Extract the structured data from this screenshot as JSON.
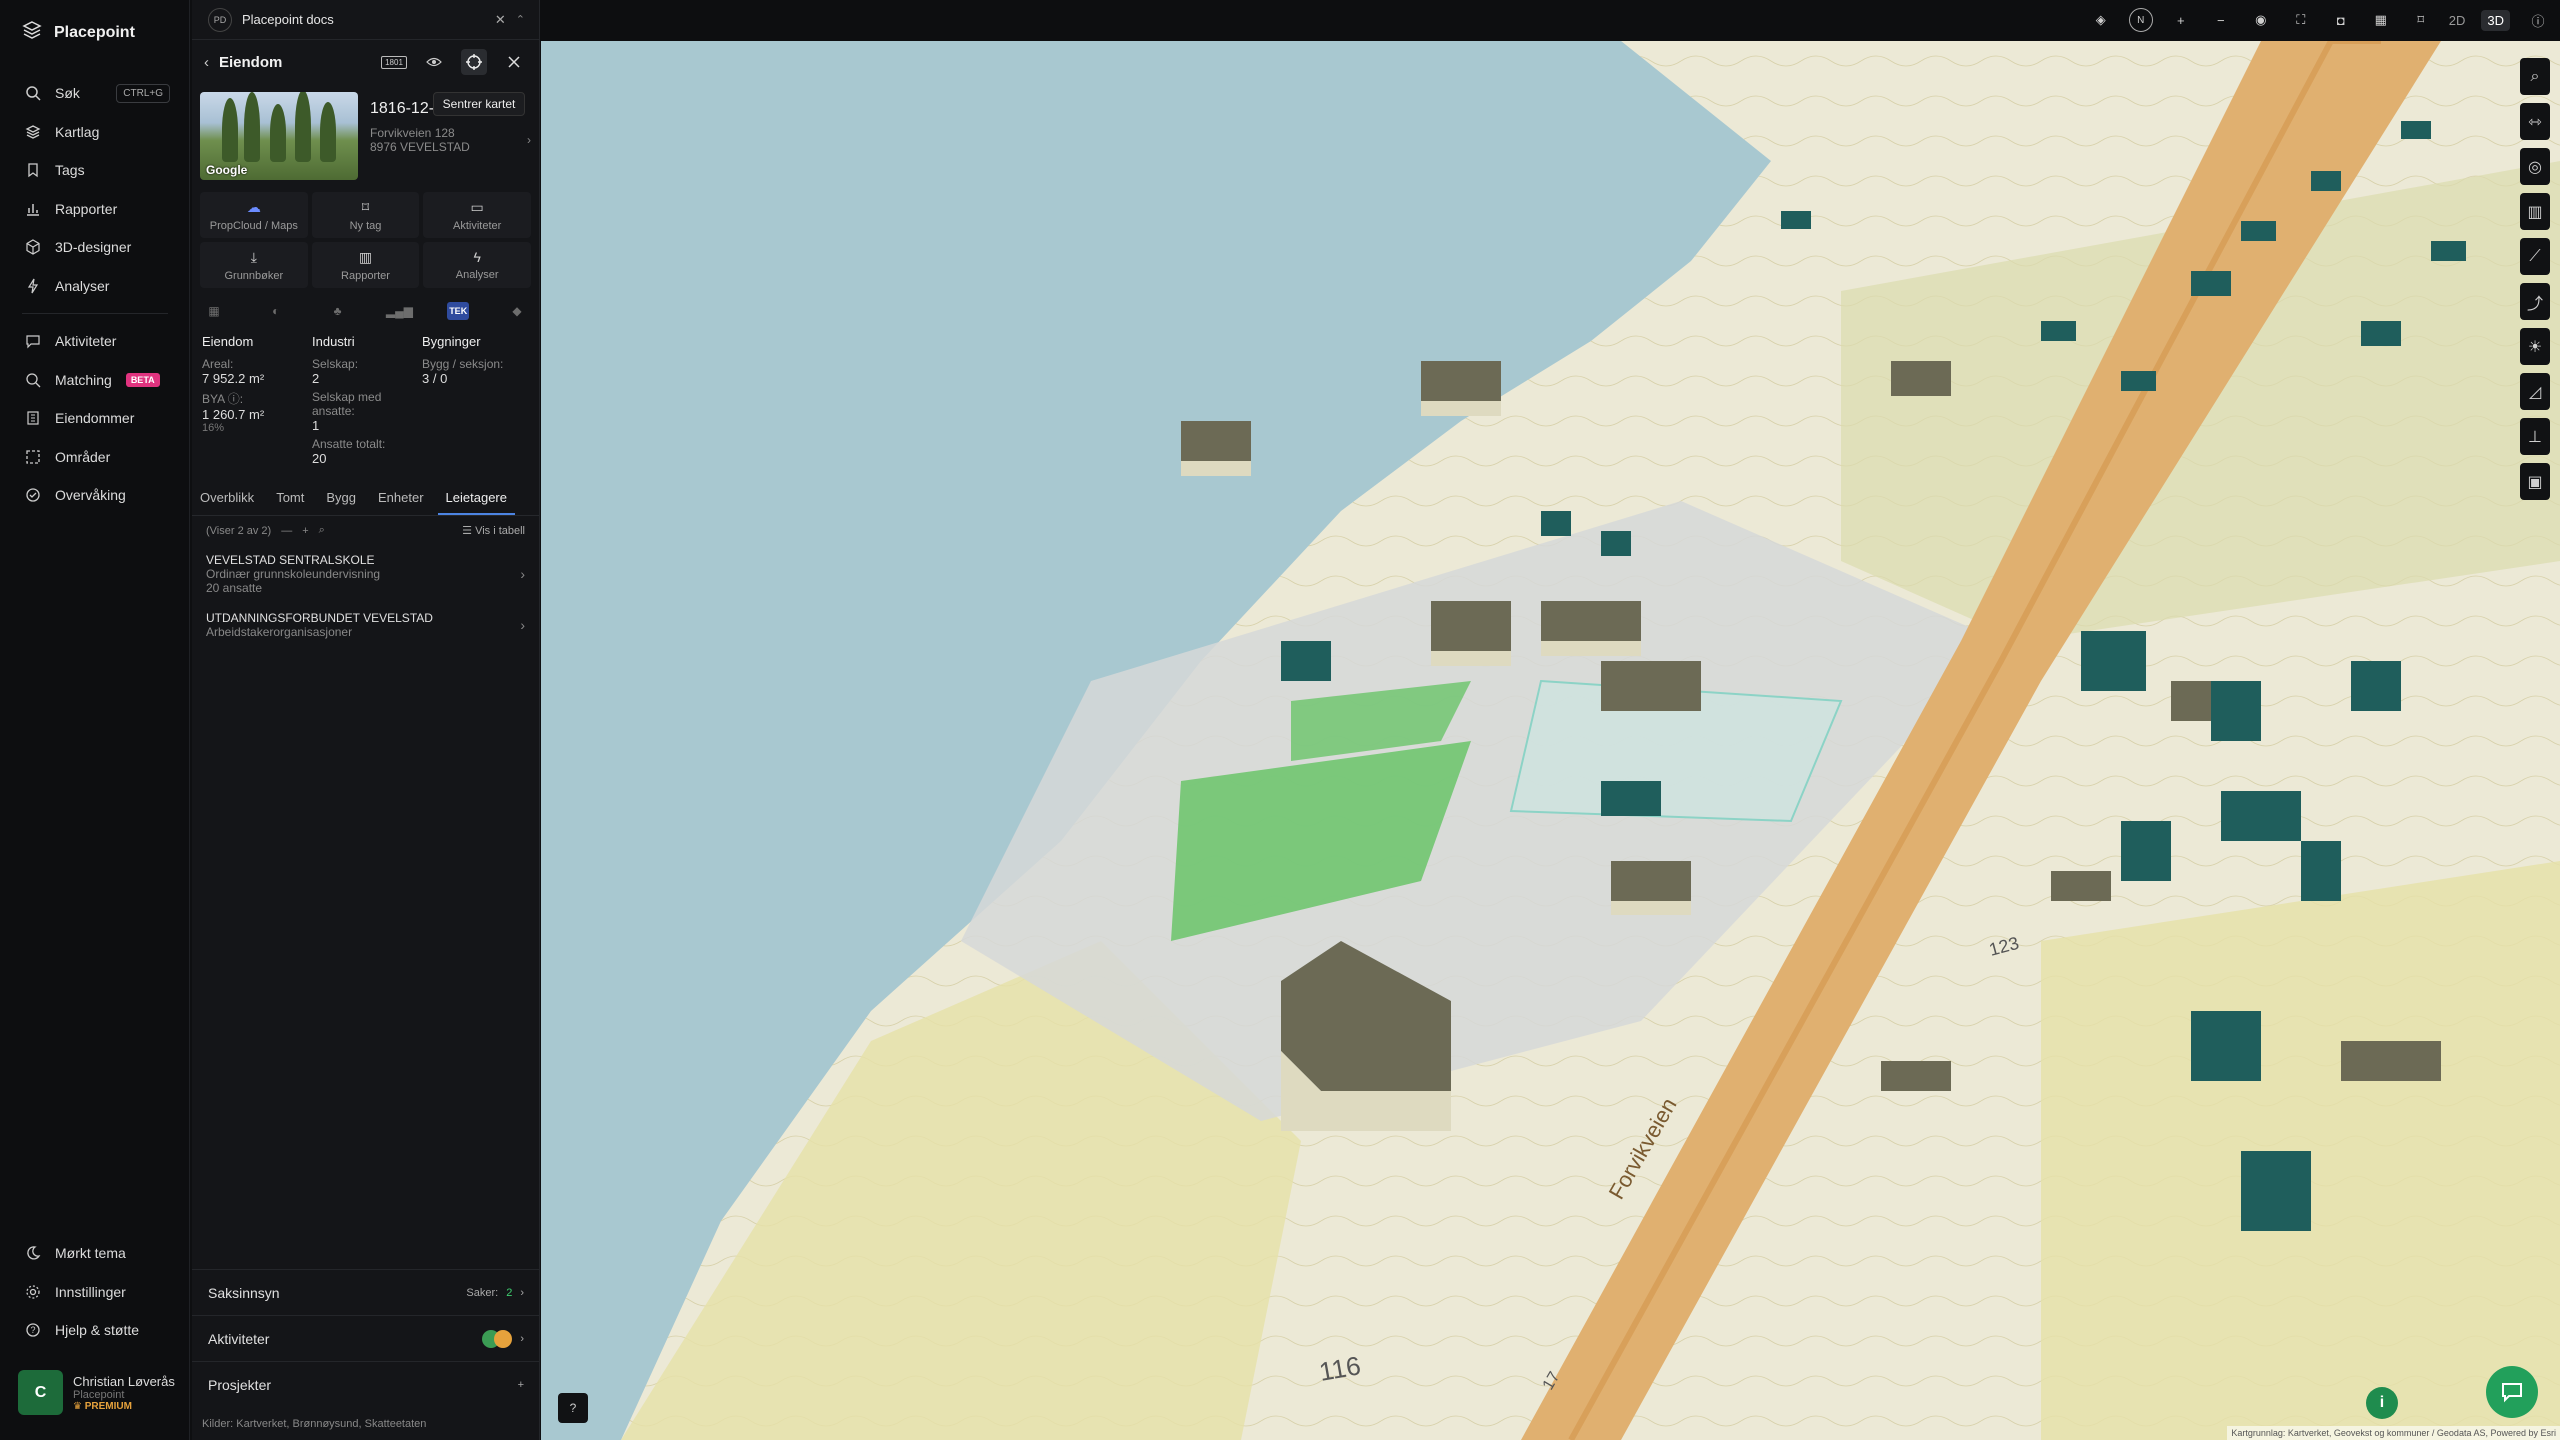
{
  "brand": {
    "name": "Placepoint"
  },
  "nav": {
    "items": [
      {
        "label": "Søk",
        "icon": "search-icon",
        "shortcut": "CTRL+G"
      },
      {
        "label": "Kartlag",
        "icon": "layers-icon"
      },
      {
        "label": "Tags",
        "icon": "bookmark-icon"
      },
      {
        "label": "Rapporter",
        "icon": "bar-chart-icon"
      },
      {
        "label": "3D-designer",
        "icon": "cube-icon"
      },
      {
        "label": "Analyser",
        "icon": "bolt-icon"
      }
    ],
    "items2": [
      {
        "label": "Aktiviteter",
        "icon": "chat-icon"
      },
      {
        "label": "Matching",
        "icon": "target-icon",
        "badge": "BETA"
      },
      {
        "label": "Eiendommer",
        "icon": "building-icon"
      },
      {
        "label": "Områder",
        "icon": "area-icon"
      },
      {
        "label": "Overvåking",
        "icon": "monitor-icon"
      }
    ],
    "bottom": [
      {
        "label": "Mørkt tema",
        "icon": "moon-icon"
      },
      {
        "label": "Innstillinger",
        "icon": "gear-icon"
      },
      {
        "label": "Hjelp & støtte",
        "icon": "help-icon"
      }
    ],
    "user": {
      "initial": "C",
      "name": "Christian Løverås",
      "org": "Placepoint",
      "tier": "PREMIUM"
    }
  },
  "panel": {
    "docs": {
      "badge": "PD",
      "title": "Placepoint docs"
    },
    "header": {
      "title": "Eiendom",
      "tooltip": "Sentrer kartet",
      "icon_1801": "1801"
    },
    "property": {
      "id": "1816-12-38-0-0",
      "address": "Forvikveien 128",
      "postal": "8976 VEVELSTAD",
      "photo_tag": "Google"
    },
    "actions": [
      {
        "label": "PropCloud / Maps",
        "icon": "cloud-icon"
      },
      {
        "label": "Ny tag",
        "icon": "bookmark-icon"
      },
      {
        "label": "Aktiviteter",
        "icon": "chat-icon"
      },
      {
        "label": "Grunnbøker",
        "icon": "download-icon"
      },
      {
        "label": "Rapporter",
        "icon": "bar-chart-icon"
      },
      {
        "label": "Analyser",
        "icon": "bolt-icon"
      }
    ],
    "tek_label": "TEK",
    "stats": {
      "eiendom": {
        "title": "Eiendom",
        "areal_label": "Areal:",
        "areal": "7 952.2 m²",
        "bya_label": "BYA ⓘ:",
        "bya": "1 260.7 m²",
        "bya_pct": "16%"
      },
      "industri": {
        "title": "Industri",
        "selskap_label": "Selskap:",
        "selskap": "2",
        "ansatte_label": "Selskap med ansatte:",
        "ansatte": "1",
        "totalt_label": "Ansatte totalt:",
        "totalt": "20"
      },
      "bygninger": {
        "title": "Bygninger",
        "label": "Bygg / seksjon:",
        "value": "3 / 0"
      }
    },
    "tabs": [
      "Overblikk",
      "Tomt",
      "Bygg",
      "Enheter",
      "Leietagere"
    ],
    "active_tab": "Leietagere",
    "list_count": "(Viser 2 av 2)",
    "table_link": "Vis i tabell",
    "lessees": [
      {
        "name": "VEVELSTAD SENTRALSKOLE",
        "desc": "Ordinær grunnskoleundervisning",
        "extra": "20 ansatte"
      },
      {
        "name": "UTDANNINGSFORBUNDET VEVELSTAD",
        "desc": "Arbeidstakerorganisasjoner",
        "extra": ""
      }
    ],
    "saksinnsyn": {
      "label": "Saksinnsyn",
      "count_label": "Saker:",
      "count": "2"
    },
    "aktiviteter": {
      "label": "Aktiviteter"
    },
    "prosjekter": {
      "label": "Prosjekter"
    },
    "sources": {
      "label": "Kilder:",
      "items": "Kartverket, Brønnøysund, Skatteetaten"
    }
  },
  "map": {
    "mode_2d": "2D",
    "mode_3d": "3D",
    "attribution": "Kartgrunnlag: Kartverket, Geovekst og kommuner / Geodata AS, Powered by Esri",
    "labels": {
      "road": "Forvikveien",
      "n116": "116",
      "n17": "17",
      "n123": "123"
    }
  }
}
